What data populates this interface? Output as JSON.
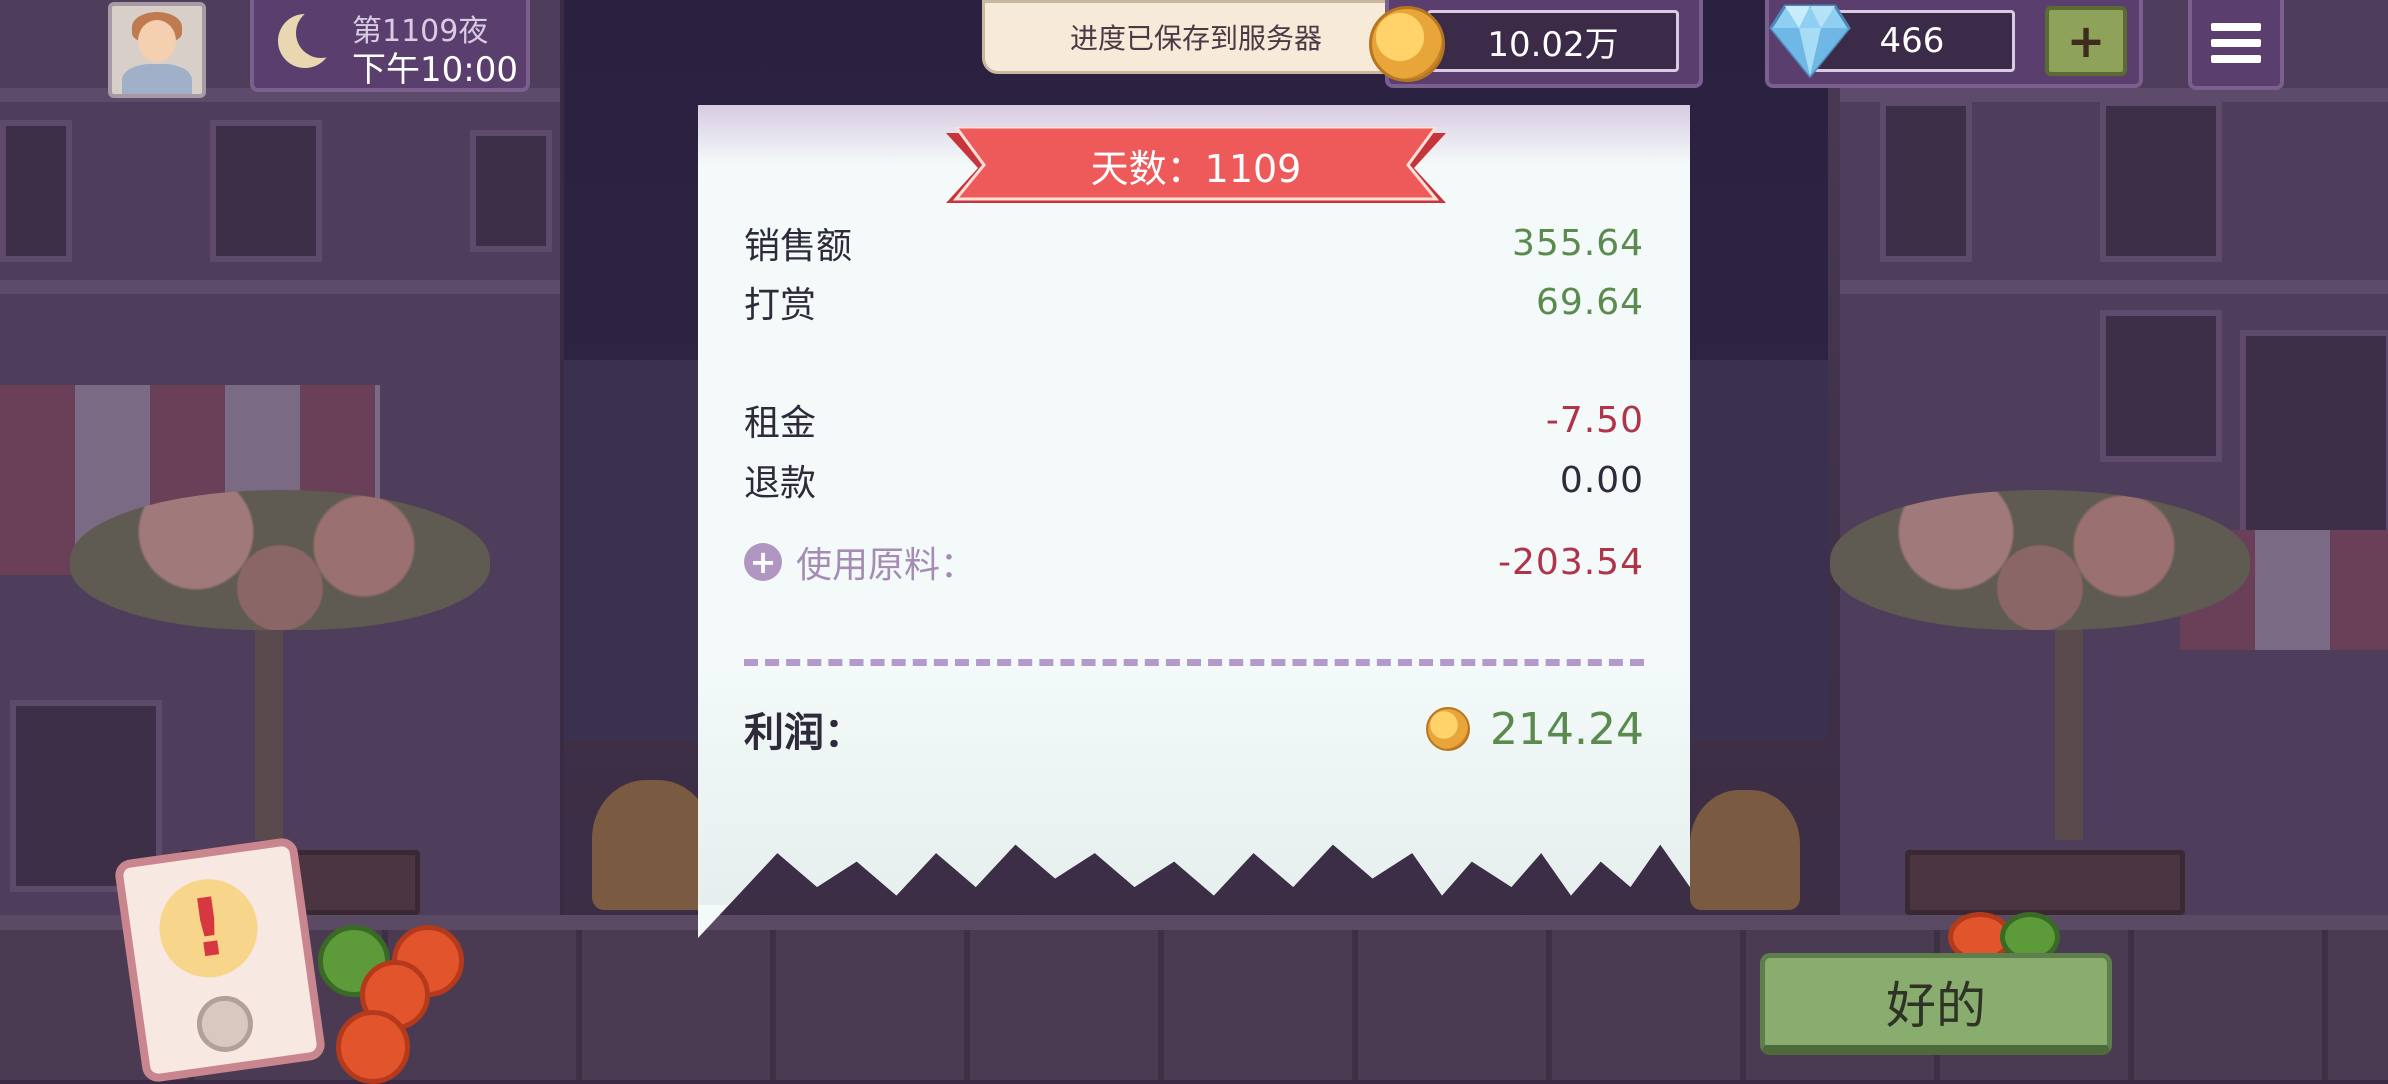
{
  "hud": {
    "night_label": "第1109夜",
    "time": "下午10:00",
    "save_toast": "进度已保存到服务器",
    "coins": "10.02万",
    "gems": "466",
    "gem_plus": "+"
  },
  "receipt": {
    "day_title": "天数：1109",
    "rows": [
      {
        "label": "销售额",
        "value": "355.64"
      },
      {
        "label": "打赏",
        "value": "69.64"
      },
      {
        "label": "租金",
        "value": "-7.50"
      },
      {
        "label": "退款",
        "value": "0.00"
      }
    ],
    "materials": {
      "label": "使用原料：",
      "value": "-203.54",
      "expand": "+"
    },
    "profit": {
      "label": "利润：",
      "value": "214.24"
    }
  },
  "alert": {
    "mark": "!"
  },
  "ok_button": "好的",
  "colors": {
    "positive": "#5a8a4e",
    "negative": "#b0334a",
    "ribbon": "#ee5a5a",
    "hud_panel": "#5a3f6e",
    "ok_button": "#88ad6e"
  },
  "icons": [
    "moon-icon",
    "coin-icon",
    "diamond-icon",
    "menu-icon",
    "plus-circle-icon",
    "alert-icon"
  ]
}
